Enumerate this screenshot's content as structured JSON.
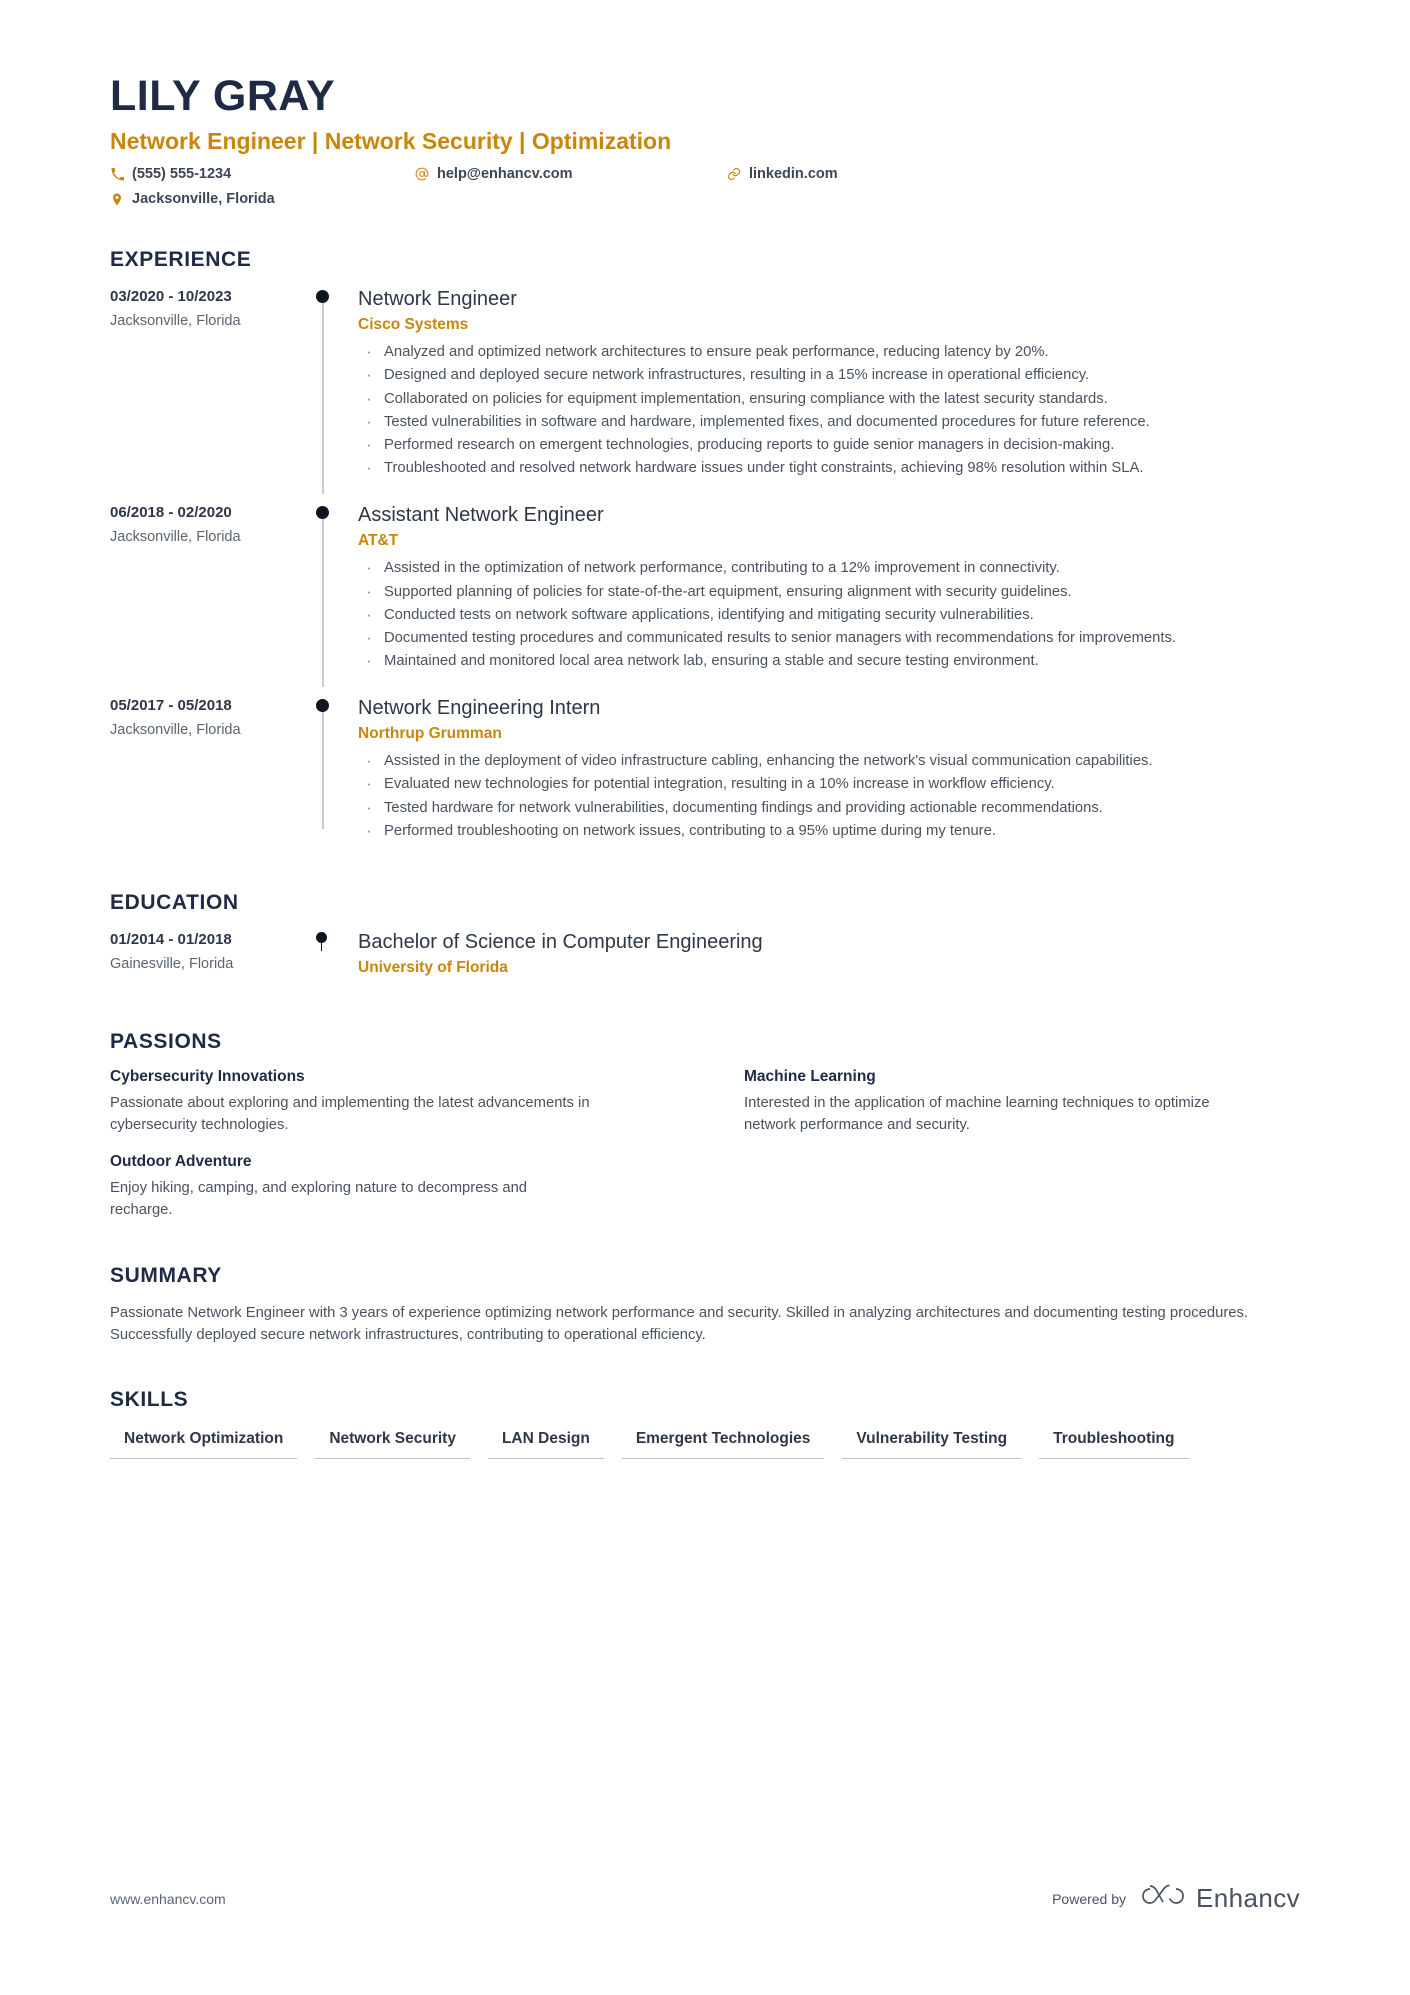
{
  "colors": {
    "accent": "#c8860d",
    "heading": "#1f2b45",
    "body": "#4a5160",
    "muted": "#5a6472",
    "rule": "#b9bec7"
  },
  "header": {
    "name": "LILY GRAY",
    "headline": "Network Engineer | Network Security | Optimization",
    "contacts": {
      "phone": "(555) 555-1234",
      "location": "Jacksonville, Florida",
      "email": "help@enhancv.com",
      "link": "linkedin.com"
    }
  },
  "sections": {
    "experience_title": "EXPERIENCE",
    "education_title": "EDUCATION",
    "passions_title": "PASSIONS",
    "summary_title": "SUMMARY",
    "skills_title": "SKILLS"
  },
  "experience": [
    {
      "dates": "03/2020 - 10/2023",
      "location": "Jacksonville, Florida",
      "title": "Network Engineer",
      "company": "Cisco Systems",
      "bullets": [
        "Analyzed and optimized network architectures to ensure peak performance, reducing latency by 20%.",
        "Designed and deployed secure network infrastructures, resulting in a 15% increase in operational efficiency.",
        "Collaborated on policies for equipment implementation, ensuring compliance with the latest security standards.",
        "Tested vulnerabilities in software and hardware, implemented fixes, and documented procedures for future reference.",
        "Performed research on emergent technologies, producing reports to guide senior managers in decision-making.",
        "Troubleshooted and resolved network hardware issues under tight constraints, achieving 98% resolution within SLA."
      ]
    },
    {
      "dates": "06/2018 - 02/2020",
      "location": "Jacksonville, Florida",
      "title": "Assistant Network Engineer",
      "company": "AT&T",
      "bullets": [
        "Assisted in the optimization of network performance, contributing to a 12% improvement in connectivity.",
        "Supported planning of policies for state-of-the-art equipment, ensuring alignment with security guidelines.",
        "Conducted tests on network software applications, identifying and mitigating security vulnerabilities.",
        "Documented testing procedures and communicated results to senior managers with recommendations for improvements.",
        "Maintained and monitored local area network lab, ensuring a stable and secure testing environment."
      ]
    },
    {
      "dates": "05/2017 - 05/2018",
      "location": "Jacksonville, Florida",
      "title": "Network Engineering Intern",
      "company": "Northrup Grumman",
      "bullets": [
        "Assisted in the deployment of video infrastructure cabling, enhancing the network's visual communication capabilities.",
        "Evaluated new technologies for potential integration, resulting in a 10% increase in workflow efficiency.",
        "Tested hardware for network vulnerabilities, documenting findings and providing actionable recommendations.",
        "Performed troubleshooting on network issues, contributing to a 95% uptime during my tenure."
      ]
    }
  ],
  "education": [
    {
      "dates": "01/2014 - 01/2018",
      "location": "Gainesville, Florida",
      "degree": "Bachelor of Science in Computer Engineering",
      "school": "University of Florida"
    }
  ],
  "passions": [
    {
      "title": "Cybersecurity Innovations",
      "text": "Passionate about exploring and implementing the latest advancements in cybersecurity technologies."
    },
    {
      "title": "Machine Learning",
      "text": "Interested in the application of machine learning techniques to optimize network performance and security."
    },
    {
      "title": "Outdoor Adventure",
      "text": "Enjoy hiking, camping, and exploring nature to decompress and recharge."
    }
  ],
  "summary": {
    "text": "Passionate Network Engineer with 3 years of experience optimizing network performance and security. Skilled in analyzing architectures and documenting testing procedures. Successfully deployed secure network infrastructures, contributing to operational efficiency."
  },
  "skills": [
    "Network Optimization",
    "Network Security",
    "LAN Design",
    "Emergent Technologies",
    "Vulnerability Testing",
    "Troubleshooting"
  ],
  "footer": {
    "url": "www.enhancv.com",
    "powered_by": "Powered by",
    "brand": "Enhancv"
  }
}
